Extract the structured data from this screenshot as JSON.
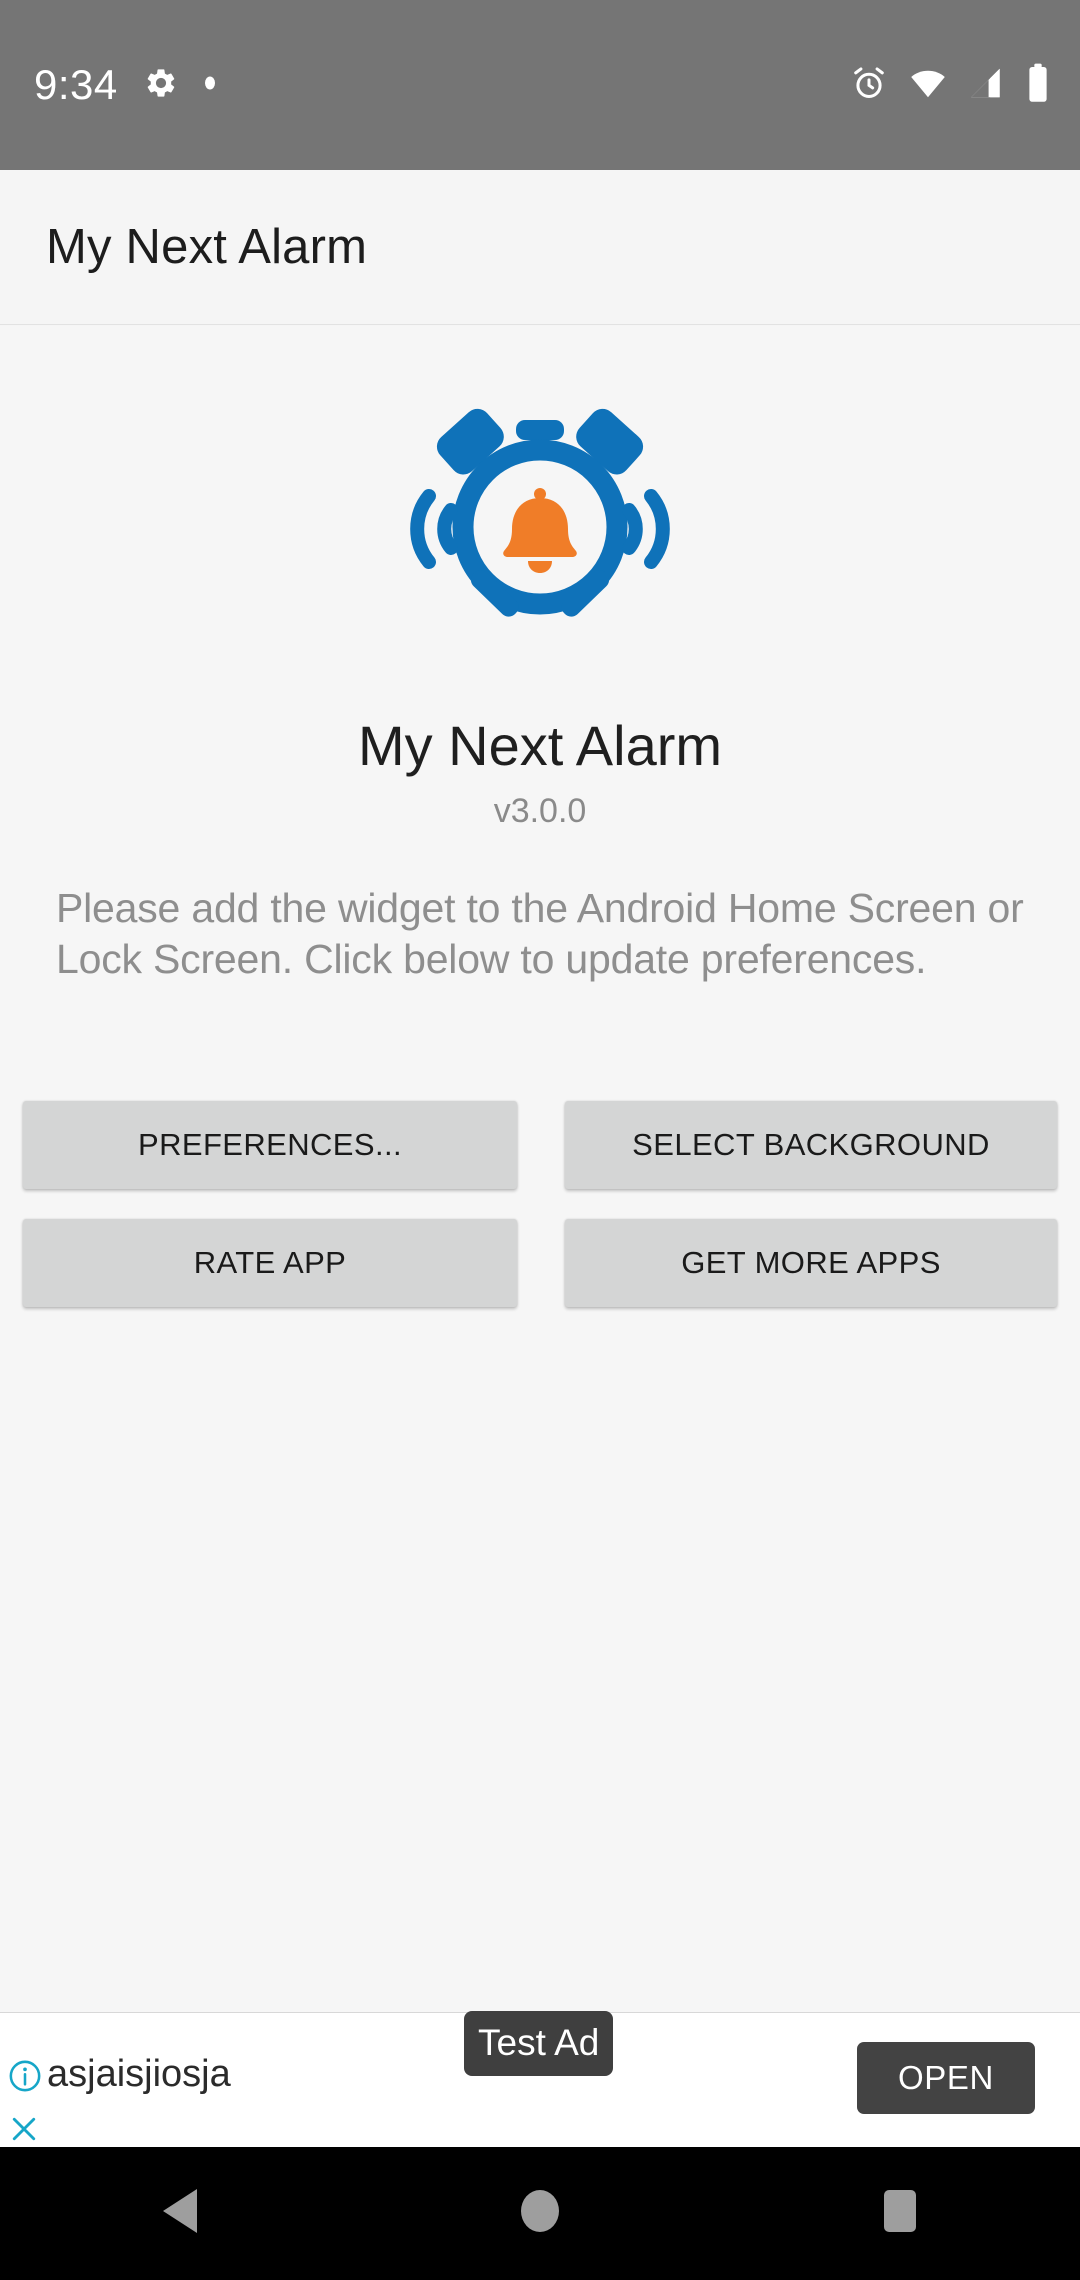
{
  "status_bar": {
    "time": "9:34",
    "icons_left": [
      "gear-icon",
      "dot-icon"
    ],
    "icons_right": [
      "alarm-icon",
      "wifi-icon",
      "signal-icon",
      "battery-icon"
    ],
    "background_color": "#757575",
    "foreground_color": "#ffffff"
  },
  "app_bar": {
    "title": "My Next Alarm",
    "background_color": "#f5f5f5",
    "text_color": "#1d1d1d"
  },
  "main": {
    "logo": {
      "icon": "alarm-clock-logo",
      "clock_color": "#0f72b9",
      "bell_color": "#f07d28"
    },
    "app_name": "My Next Alarm",
    "version": "v3.0.0",
    "description": "Please add the widget to the Android Home Screen or Lock Screen. Click below to update preferences.",
    "buttons": [
      {
        "label": "PREFERENCES...",
        "name": "preferences-button"
      },
      {
        "label": "SELECT BACKGROUND",
        "name": "select-background-button"
      },
      {
        "label": "RATE APP",
        "name": "rate-app-button"
      },
      {
        "label": "GET MORE APPS",
        "name": "get-more-apps-button"
      }
    ],
    "button_color": "#d4d5d5",
    "button_text_color": "#1a1a1a"
  },
  "ad": {
    "badge_label": "Test Ad",
    "title": "asjaisjiosja",
    "cta_label": "OPEN",
    "info_icon": "info-icon",
    "close_icon": "close-icon",
    "accent_color": "#16a6c8",
    "badge_color": "#3f3f3f",
    "cta_color": "#434343"
  },
  "nav_bar": {
    "buttons": [
      {
        "name": "back-button",
        "icon": "triangle-back-icon"
      },
      {
        "name": "home-button",
        "icon": "circle-home-icon"
      },
      {
        "name": "recents-button",
        "icon": "square-recents-icon"
      }
    ],
    "background_color": "#000000",
    "icon_color": "#9e9e9e"
  }
}
